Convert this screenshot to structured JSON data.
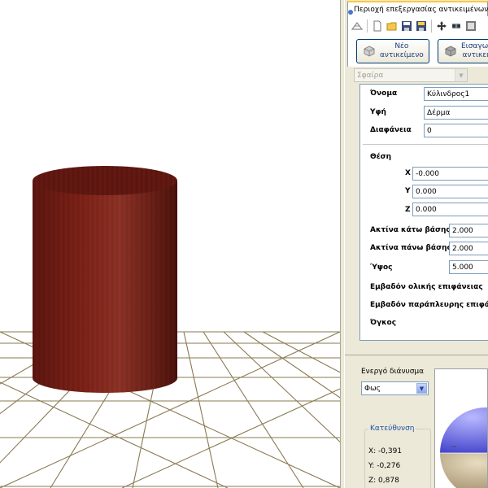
{
  "panel": {
    "tab_title": "Περιοχή επεξεργασίας αντικειμένων",
    "new_object_label": "Νέο\nαντικείμενο",
    "import_label": "Εισαγωγή\nαντικειμ.",
    "object_select_value": "Σφαίρα"
  },
  "toolbar": {
    "icons": [
      "plane-icon",
      "new-file-icon",
      "open-folder-icon",
      "save-icon",
      "save-as-icon",
      "move-icon",
      "rotate-icon",
      "window-icon"
    ]
  },
  "properties": {
    "name_label": "Όνομα",
    "name_value": "Κύλινδρος1",
    "texture_label": "Υφή",
    "texture_value": "Δέρμα",
    "transparency_label": "Διαφάνεια",
    "transparency_value": "0",
    "position_label": "Θέση",
    "x_label": "X",
    "x_value": "-0.000",
    "y_label": "Y",
    "y_value": "0.000",
    "z_label": "Z",
    "z_value": "0.000",
    "bottom_radius_label": "Ακτίνα κάτω βάσης",
    "bottom_radius_value": "2.000",
    "top_radius_label": "Ακτίνα πάνω βάσης",
    "top_radius_value": "2.000",
    "height_label": "Ύψος",
    "height_value": "5.000",
    "total_area_label": "Εμβαδόν ολικής επιφάνειας",
    "lateral_area_label": "Εμβαδόν παράπλευρης επιφάν",
    "volume_label": "Όγκος"
  },
  "vector": {
    "label": "Ενεργό διάνυσμα",
    "select_value": "Φως",
    "direction_title": "Κατεύθυνση",
    "x_text": "X: -0,391",
    "y_text": "Y: -0,276",
    "z_text": "Z: 0,878"
  },
  "colors": {
    "cylinder": "#6e1a12",
    "grid": "#8a7a52",
    "panel_bg": "#ece9d8",
    "sphere_top": "#5a5ad8",
    "sphere_bottom": "#b09a70"
  }
}
